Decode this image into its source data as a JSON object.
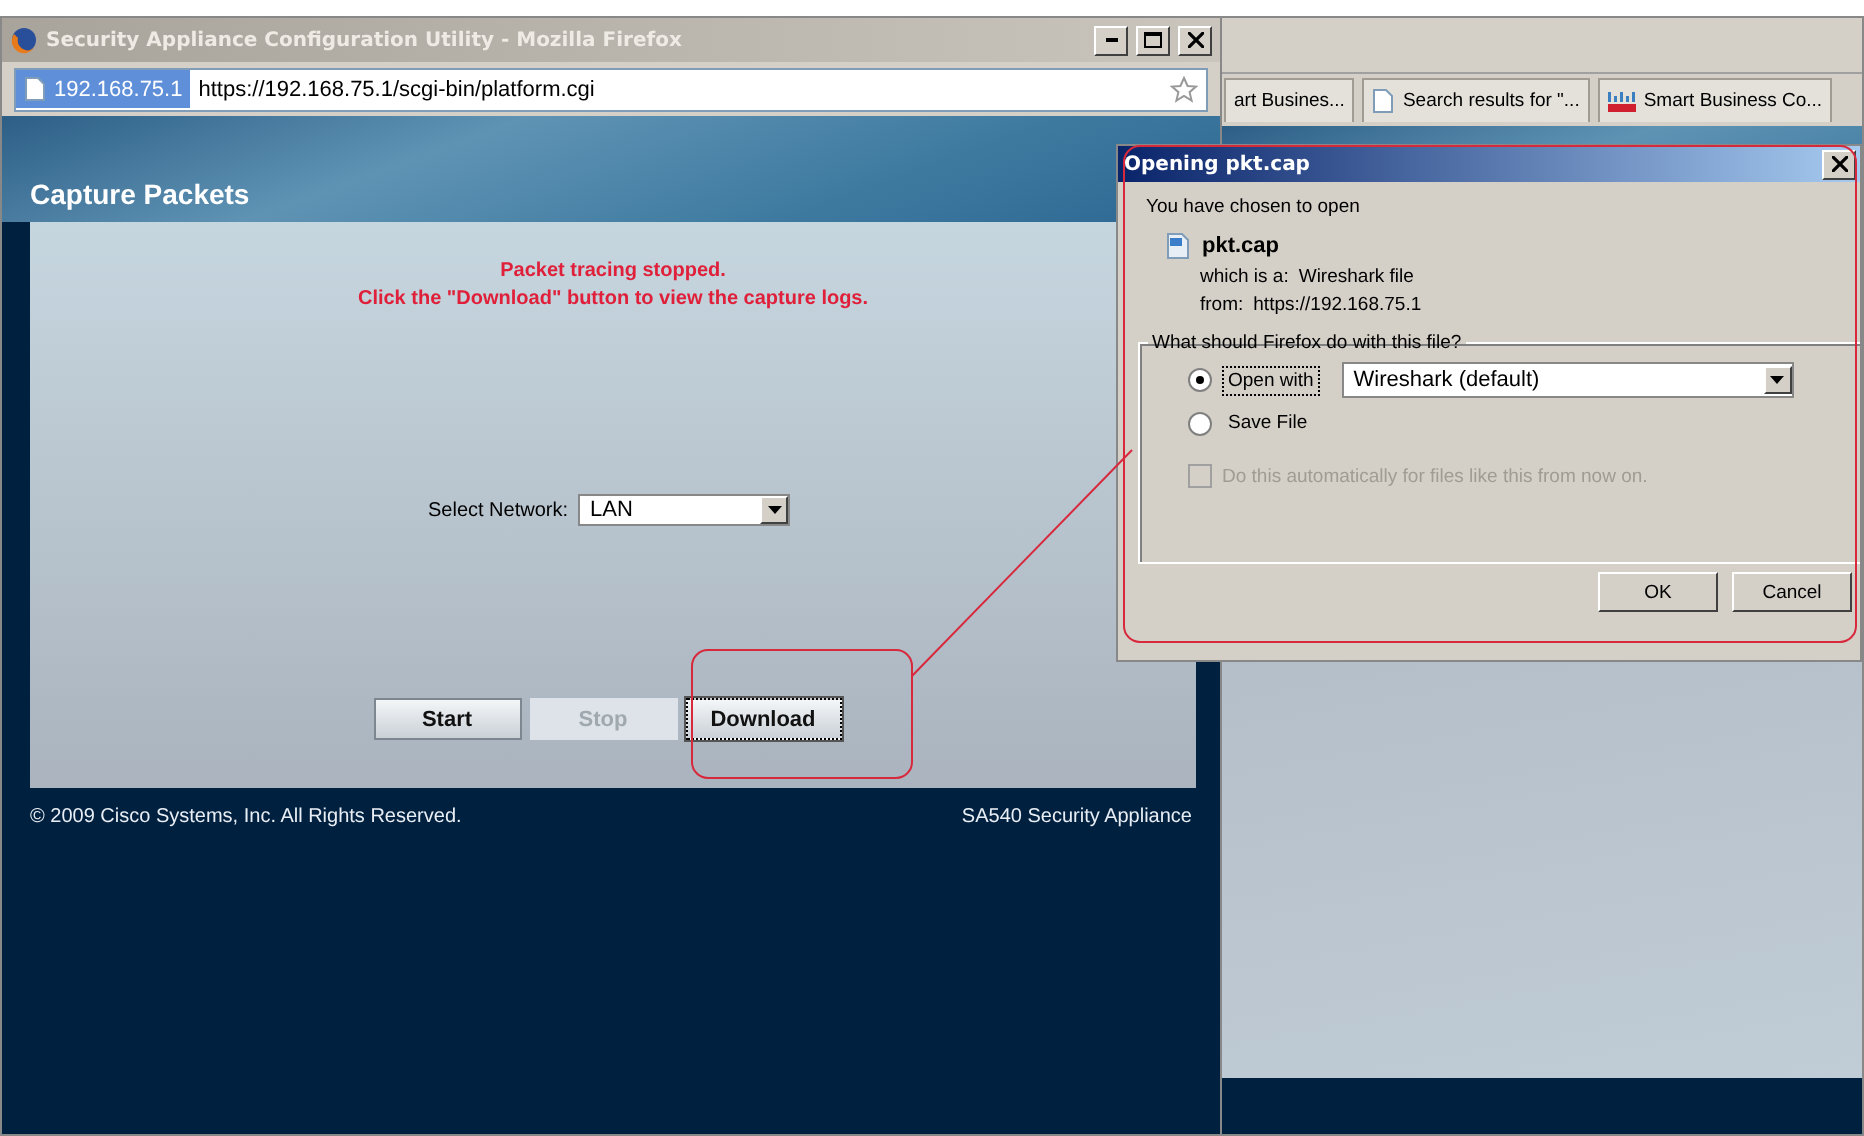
{
  "popup_window": {
    "title": "Security Appliance Configuration Utility - Mozilla Firefox",
    "address_host": "192.168.75.1",
    "address_url": "https://192.168.75.1/scgi-bin/platform.cgi"
  },
  "page": {
    "heading": "Capture Packets",
    "status_lines": [
      "Packet tracing stopped.",
      "Click the \"Download\" button to view the capture logs."
    ],
    "network_label": "Select Network:",
    "network_value": "LAN",
    "buttons": [
      {
        "label": "Start",
        "disabled": false,
        "focused": false
      },
      {
        "label": "Stop",
        "disabled": true,
        "focused": false
      },
      {
        "label": "Download",
        "disabled": false,
        "focused": true
      }
    ],
    "footer_left": "© 2009 Cisco Systems, Inc. All Rights Reserved.",
    "footer_right": "SA540 Security Appliance"
  },
  "background_browser": {
    "tabs": [
      {
        "label": "art Busines...",
        "kind": "plain"
      },
      {
        "label": "Search results for \"...",
        "kind": "page"
      },
      {
        "label": "Smart Business Co...",
        "kind": "logo"
      }
    ]
  },
  "dialog": {
    "title": "Opening pkt.cap",
    "intro": "You have chosen to open",
    "file_name": "pkt.cap",
    "type_label": "which is a:",
    "type_value": "Wireshark file",
    "from_label": "from:",
    "from_value": "https://192.168.75.1",
    "group_label": "What should Firefox do with this file?",
    "options": [
      {
        "label": "Open with",
        "selected": true
      },
      {
        "label": "Save File",
        "selected": false
      }
    ],
    "app_value": "Wireshark (default)",
    "auto_checkbox": {
      "label": "Do this automatically for files like this from now on.",
      "checked": false,
      "disabled": true
    },
    "buttons": [
      "OK",
      "Cancel"
    ]
  }
}
